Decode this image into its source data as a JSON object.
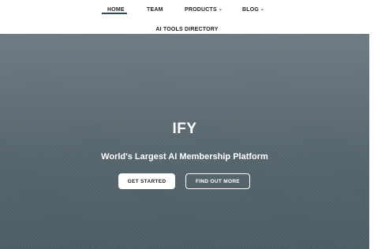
{
  "nav": {
    "home": "HOME",
    "team": "TEAM",
    "products": "PRODUCTS",
    "blog": "BLOG",
    "directory": "AI TOOLS DIRECTORY",
    "chevron": "⌄"
  },
  "hero": {
    "title": "IFY",
    "subtitle": "World's Largest AI Membership Platform",
    "primary_button": "GET STARTED",
    "secondary_button": "FIND OUT MORE"
  },
  "colors": {
    "accent": "#2e4755",
    "hero_bg": "#5a6870",
    "text_dark": "#222222",
    "text_light": "#ffffff"
  },
  "icons": {
    "products_dropdown": "chevron-down-icon",
    "blog_dropdown": "chevron-down-icon"
  }
}
